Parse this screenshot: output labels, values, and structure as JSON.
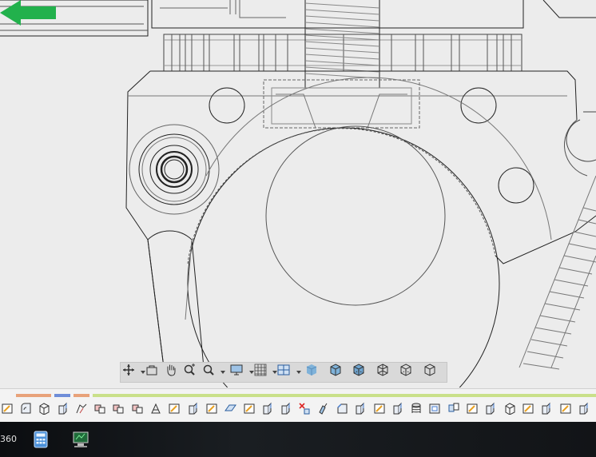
{
  "app": {
    "taskbar_label": "360"
  },
  "navigation_bar": {
    "tools": [
      {
        "name": "orbit-icon",
        "has_menu": true
      },
      {
        "name": "look-at-icon",
        "has_menu": false
      },
      {
        "name": "pan-icon",
        "has_menu": false
      },
      {
        "name": "zoom-icon",
        "has_menu": false
      },
      {
        "name": "zoom-window-icon",
        "has_menu": true
      },
      {
        "name": "display-settings-icon",
        "has_menu": true
      },
      {
        "name": "grid-settings-icon",
        "has_menu": true
      },
      {
        "name": "viewports-icon",
        "has_menu": true
      },
      {
        "name": "visual-style-shaded-icon",
        "has_menu": false
      },
      {
        "name": "visual-style-shaded-edges-icon",
        "has_menu": false
      },
      {
        "name": "visual-style-shaded-hidden-icon",
        "has_menu": false
      },
      {
        "name": "visual-style-wireframe-icon",
        "has_menu": false
      },
      {
        "name": "visual-style-hidden-edges-icon",
        "has_menu": false
      },
      {
        "name": "visual-style-visible-edges-icon",
        "has_menu": false
      }
    ]
  },
  "annotation": {
    "arrow_color": "#22b14c",
    "arrow_direction": "left"
  },
  "timeline": {
    "strip_colors": [
      "#e8a27a",
      "#6f8ed8",
      "#e8a27a",
      "#c9e08a"
    ],
    "items": [
      "sketch-icon",
      "fillet-icon",
      "box-icon",
      "extrude-icon",
      "loft-icon",
      "combine-icon",
      "combine-icon",
      "combine-icon",
      "sweep-icon",
      "sketch-icon",
      "extrude-icon",
      "sketch-icon",
      "plane-icon",
      "sketch-icon",
      "extrude-icon",
      "extrude-icon",
      "delete-icon",
      "move-icon",
      "chamfer-icon",
      "extrude-icon",
      "sketch-icon",
      "extrude-icon",
      "thread-icon",
      "hole-icon",
      "mirror-icon",
      "sketch-icon",
      "extrude-icon",
      "box-icon",
      "sketch-icon",
      "extrude-icon",
      "sketch-icon",
      "extrude-icon",
      "extrude-icon"
    ]
  },
  "taskbar": {
    "icons": [
      "calculator-icon",
      "computer-icon"
    ]
  }
}
